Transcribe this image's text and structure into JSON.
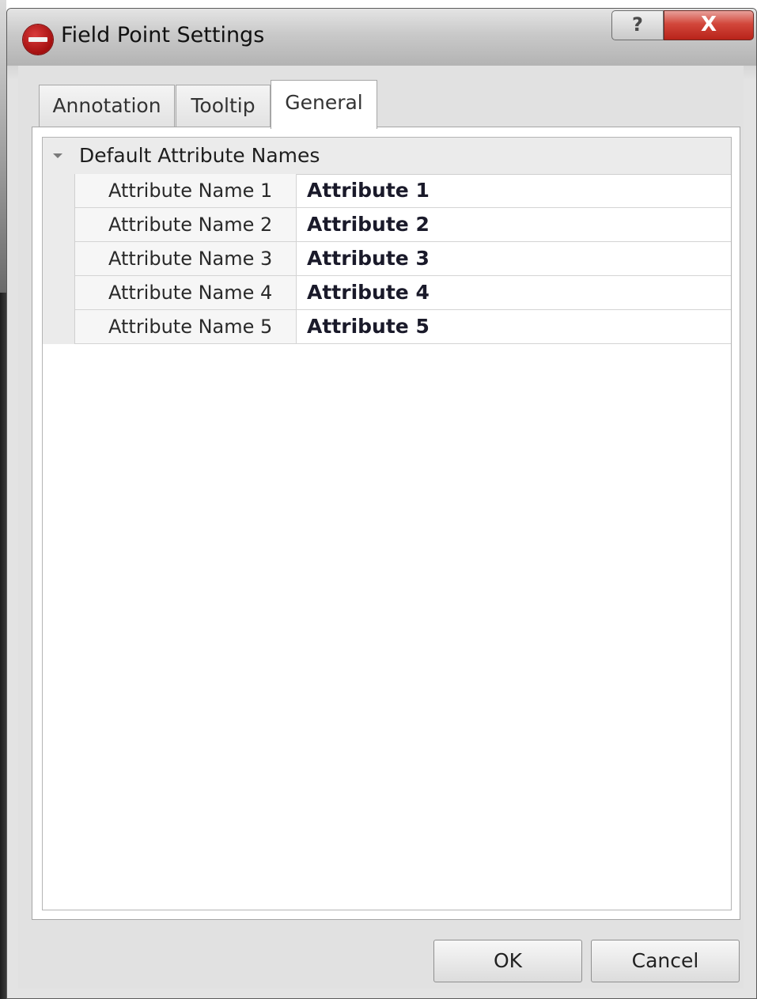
{
  "window": {
    "title": "Field Point Settings",
    "help_glyph": "?",
    "close_glyph": "X",
    "icons": {
      "app": "hilti-logo-icon",
      "help": "help-icon",
      "close": "close-icon"
    }
  },
  "tabs": [
    {
      "label": "Annotation",
      "selected": false
    },
    {
      "label": "Tooltip",
      "selected": false
    },
    {
      "label": "General",
      "selected": true
    }
  ],
  "property_grid": {
    "category": {
      "label": "Default Attribute Names",
      "expanded": true,
      "expander_icon": "collapse-triangle-icon"
    },
    "rows": [
      {
        "name": "Attribute Name 1",
        "value": "Attribute 1"
      },
      {
        "name": "Attribute Name 2",
        "value": "Attribute 2"
      },
      {
        "name": "Attribute Name 3",
        "value": "Attribute 3"
      },
      {
        "name": "Attribute Name 4",
        "value": "Attribute 4"
      },
      {
        "name": "Attribute Name 5",
        "value": "Attribute 5"
      }
    ]
  },
  "buttons": {
    "ok": "OK",
    "cancel": "Cancel"
  },
  "colors": {
    "close_button": "#c9372c",
    "logo": "#b01818",
    "selected_tab": "#ffffff"
  }
}
